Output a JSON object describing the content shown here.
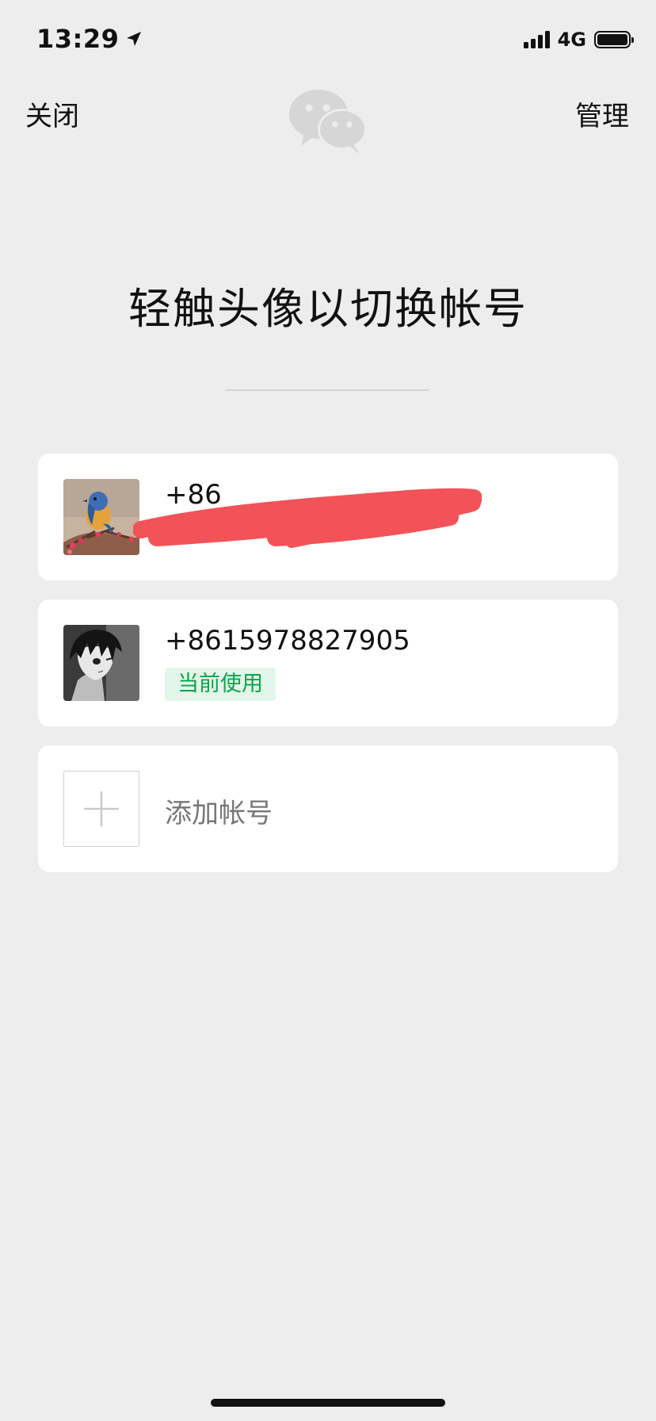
{
  "status_bar": {
    "time": "13:29",
    "network": "4G"
  },
  "nav": {
    "close_label": "关闭",
    "manage_label": "管理"
  },
  "headline": "轻触头像以切换帐号",
  "accounts": [
    {
      "number": "+86",
      "redacted": true
    },
    {
      "number": "+8615978827905",
      "badge": "当前使用"
    }
  ],
  "add_account_label": "添加帐号",
  "colors": {
    "background": "#ededed",
    "card": "#ffffff",
    "badge_bg": "#e3f6ea",
    "badge_text": "#0aa549",
    "redaction": "#f25358"
  }
}
